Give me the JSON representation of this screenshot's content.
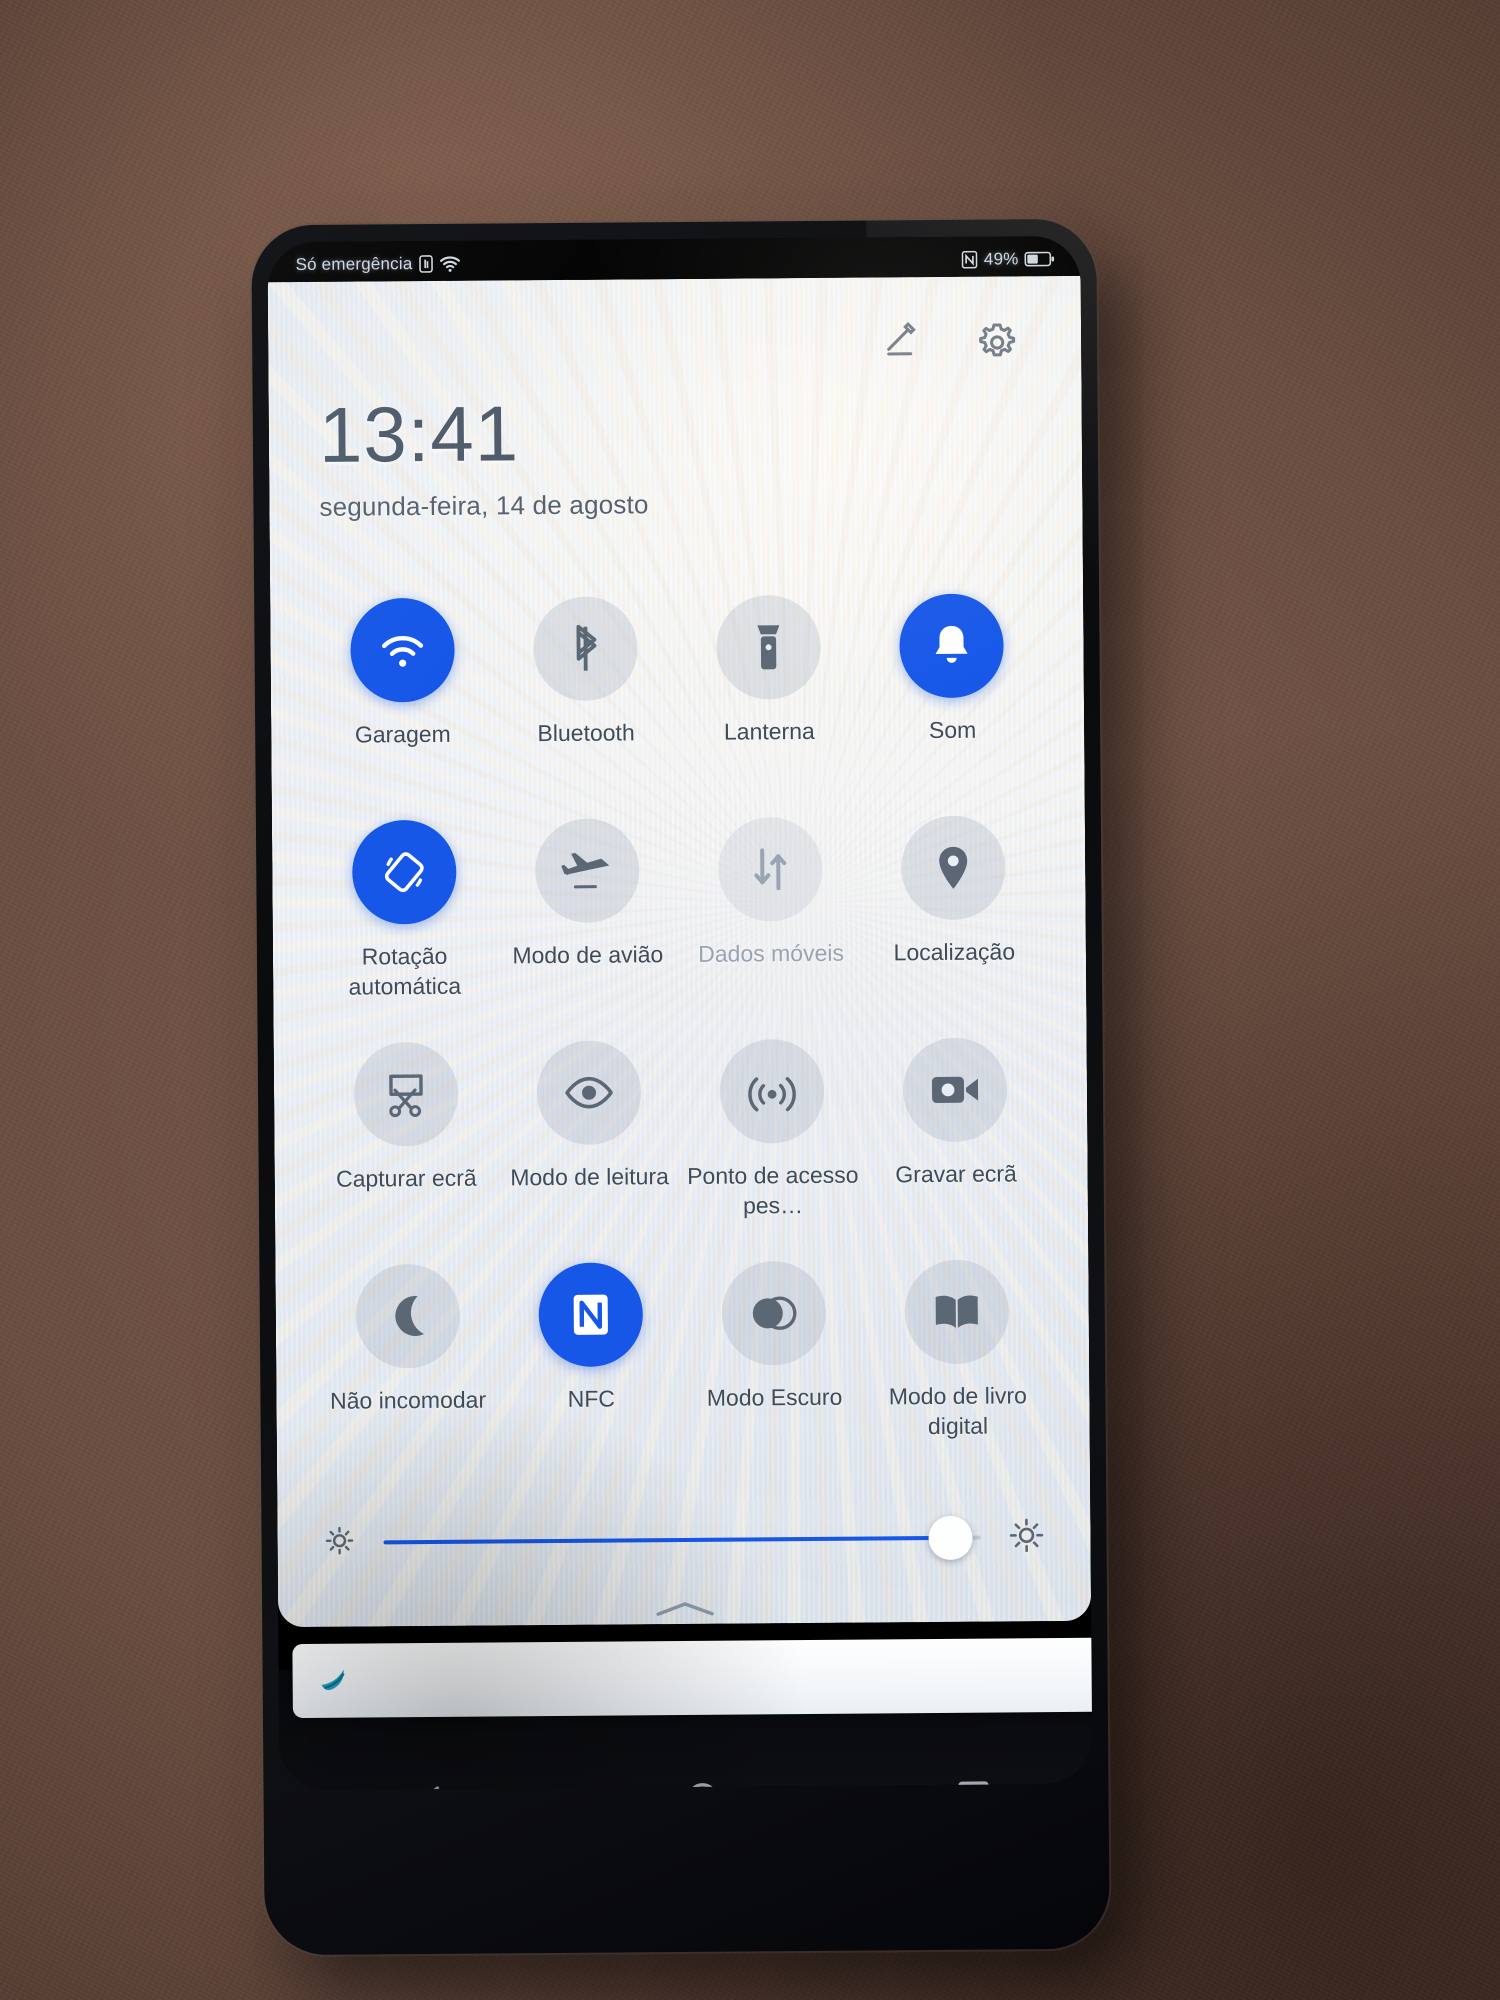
{
  "statusbar": {
    "carrier": "Só emergência",
    "signal_icon": "sim-signal-icon",
    "wifi_icon": "wifi-icon",
    "nfc_indicator_icon": "nfc-indicator-icon",
    "battery_percent": "49%",
    "battery_icon": "battery-icon"
  },
  "header": {
    "edit_icon": "pencil-edit-icon",
    "settings_icon": "gear-icon"
  },
  "clock": {
    "time": "13:41",
    "date": "segunda-feira, 14 de agosto"
  },
  "colors": {
    "accent_on": "#1657e8",
    "tile_off_bg": "#96a3b4",
    "label": "#3f4b59",
    "label_muted": "#99a4b3"
  },
  "tiles": [
    {
      "label": "Garagem",
      "icon": "wifi-icon",
      "state": "on"
    },
    {
      "label": "Bluetooth",
      "icon": "bluetooth-icon",
      "state": "off"
    },
    {
      "label": "Lanterna",
      "icon": "flashlight-icon",
      "state": "off"
    },
    {
      "label": "Som",
      "icon": "bell-sound-icon",
      "state": "on"
    },
    {
      "label": "Rotação automática",
      "icon": "auto-rotate-icon",
      "state": "on"
    },
    {
      "label": "Modo de avião",
      "icon": "airplane-icon",
      "state": "off"
    },
    {
      "label": "Dados móveis",
      "icon": "mobile-data-icon",
      "state": "disabled"
    },
    {
      "label": "Localização",
      "icon": "location-pin-icon",
      "state": "off"
    },
    {
      "label": "Capturar ecrã",
      "icon": "screenshot-icon",
      "state": "off"
    },
    {
      "label": "Modo de leitura",
      "icon": "eye-comfort-icon",
      "state": "off"
    },
    {
      "label": "Ponto de acesso pes…",
      "icon": "hotspot-icon",
      "state": "off"
    },
    {
      "label": "Gravar ecrã",
      "icon": "screen-record-icon",
      "state": "off"
    },
    {
      "label": "Não incomodar",
      "icon": "moon-dnd-icon",
      "state": "off"
    },
    {
      "label": "NFC",
      "icon": "nfc-icon",
      "state": "on"
    },
    {
      "label": "Modo Escuro",
      "icon": "dark-mode-icon",
      "state": "off"
    },
    {
      "label": "Modo de livro digital",
      "icon": "e-book-icon",
      "state": "off"
    }
  ],
  "brightness": {
    "low_icon": "brightness-low-icon",
    "high_icon": "brightness-high-icon",
    "value_percent": 95
  },
  "collapse_handle_icon": "chevron-up-icon",
  "keyboard_strip": {
    "logo_icon": "swiftkey-logo-icon",
    "suggestion": ""
  },
  "navbar": {
    "back_icon": "back-triangle-icon",
    "home_icon": "home-circle-icon",
    "recents_icon": "recents-square-icon"
  }
}
